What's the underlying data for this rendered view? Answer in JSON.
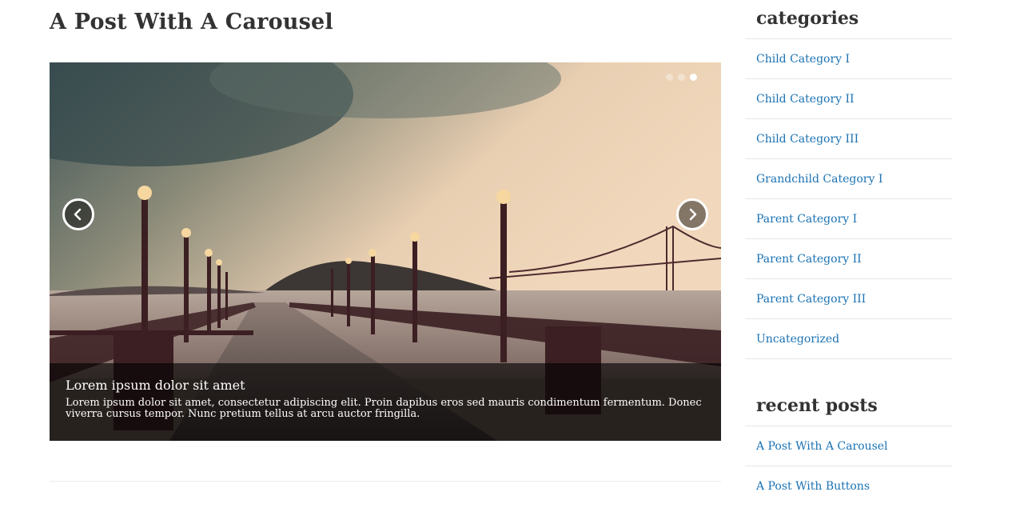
{
  "post": {
    "title": "A Post With A Carousel"
  },
  "carousel": {
    "slides_count": 3,
    "active_slide": 3,
    "caption_title": "Lorem ipsum dolor sit amet",
    "caption_text": "Lorem ipsum dolor sit amet, consectetur adipiscing elit. Proin dapibus eros sed mauris condimentum fermentum. Donec viverra cursus tempor. Nunc pretium tellus at arcu auctor fringilla.",
    "prev_icon": "chevron-left-icon",
    "next_icon": "chevron-right-icon",
    "image": "pier-with-street-lamps-and-bridge-at-dusk"
  },
  "sidebar": {
    "categories_title": "categories",
    "categories": [
      "Child Category I",
      "Child Category II",
      "Child Category III",
      "Grandchild Category I",
      "Parent Category I",
      "Parent Category II",
      "Parent Category III",
      "Uncategorized"
    ],
    "recent_posts_title": "recent posts",
    "recent_posts": [
      "A Post With A Carousel",
      "A Post With Buttons"
    ]
  },
  "colors": {
    "link": "#1a72b4",
    "heading": "#333333",
    "divider": "#e6e6e6"
  }
}
